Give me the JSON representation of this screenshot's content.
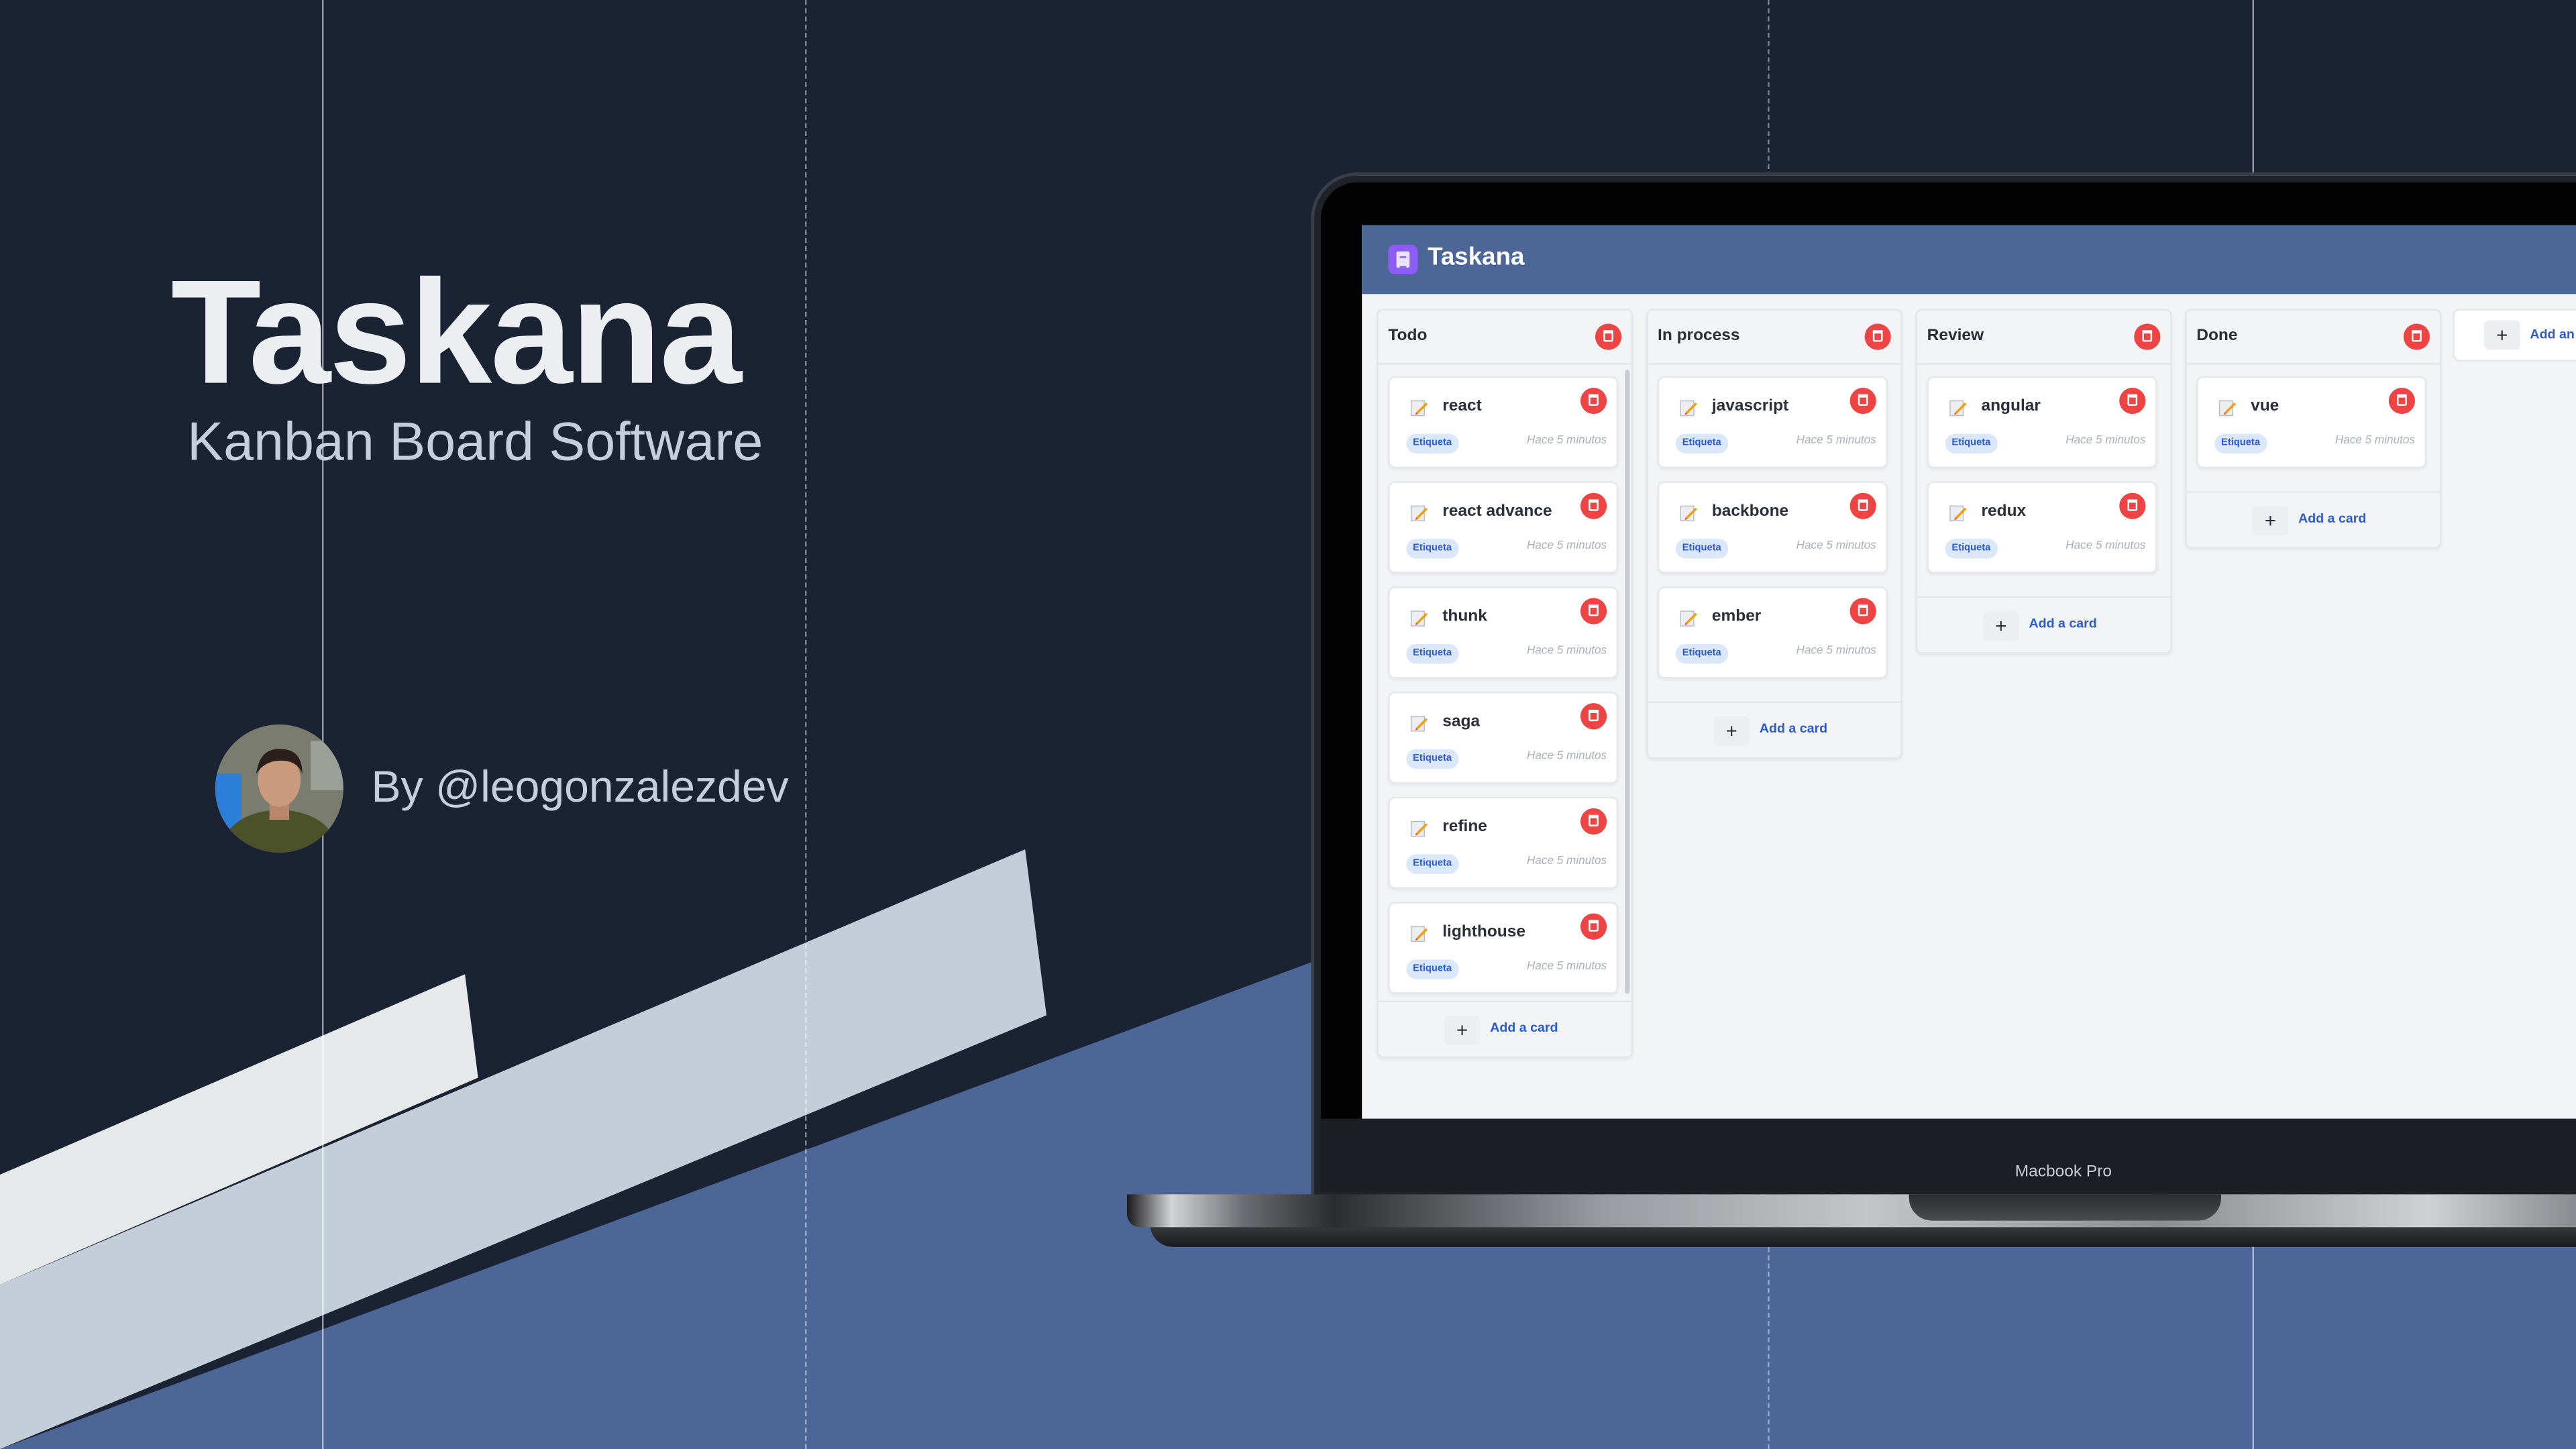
{
  "hero": {
    "title": "Taskana",
    "subtitle": "Kanban Board Software",
    "byline": "By @leogonzalezdev"
  },
  "laptop": {
    "model_label": "Macbook Pro"
  },
  "app": {
    "name": "Taskana",
    "add_card_label": "Add a card",
    "add_column_label": "Add an",
    "columns": [
      {
        "title": "Todo",
        "cards": [
          {
            "title": "react",
            "tag": "Etiqueta",
            "time": "Hace 5 minutos"
          },
          {
            "title": "react advance",
            "tag": "Etiqueta",
            "time": "Hace 5 minutos"
          },
          {
            "title": "thunk",
            "tag": "Etiqueta",
            "time": "Hace 5 minutos"
          },
          {
            "title": "saga",
            "tag": "Etiqueta",
            "time": "Hace 5 minutos"
          },
          {
            "title": "refine",
            "tag": "Etiqueta",
            "time": "Hace 5 minutos"
          },
          {
            "title": "lighthouse",
            "tag": "Etiqueta",
            "time": "Hace 5 minutos"
          }
        ]
      },
      {
        "title": "In process",
        "cards": [
          {
            "title": "javascript",
            "tag": "Etiqueta",
            "time": "Hace 5 minutos"
          },
          {
            "title": "backbone",
            "tag": "Etiqueta",
            "time": "Hace 5 minutos"
          },
          {
            "title": "ember",
            "tag": "Etiqueta",
            "time": "Hace 5 minutos"
          }
        ]
      },
      {
        "title": "Review",
        "cards": [
          {
            "title": "angular",
            "tag": "Etiqueta",
            "time": "Hace 5 minutos"
          },
          {
            "title": "redux",
            "tag": "Etiqueta",
            "time": "Hace 5 minutos"
          }
        ]
      },
      {
        "title": "Done",
        "cards": [
          {
            "title": "vue",
            "tag": "Etiqueta",
            "time": "Hace 5 minutos"
          }
        ]
      }
    ]
  },
  "colors": {
    "page_bg": "#1b2233",
    "accent_blue": "#4c6797",
    "light_stripe": "#c3ced8",
    "delete_red": "#ef4444",
    "tag_bg": "#dbe8fb",
    "link_blue": "#2b5ccf"
  },
  "icons": {
    "card": "pencil-note-icon",
    "delete": "trash-icon",
    "add": "plus-icon",
    "logo": "notebook-icon"
  }
}
